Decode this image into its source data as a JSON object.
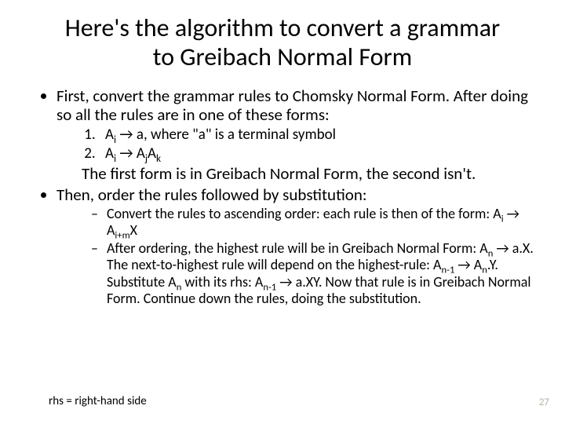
{
  "title": "Here's the algorithm to convert a grammar to Greibach Normal Form",
  "bullet1": "First, convert the grammar rules to Chomsky Normal Form. After doing so all the rules are in one of these forms:",
  "form1_pre": "A",
  "form1_sub": "i",
  "form1_post": " → a,   where \"a\" is a terminal symbol",
  "form2_lhs_pre": "A",
  "form2_lhs_sub": "i",
  "form2_arrow": " → ",
  "form2_r1_pre": "A",
  "form2_r1_sub": "j",
  "form2_r2_pre": "A",
  "form2_r2_sub": "k",
  "midnote": "The first form is in Greibach Normal Form, the second isn't.",
  "bullet2": "Then, order the rules followed by substitution:",
  "dash1_a": "Convert the rules to ascending order: each rule is then of the form: A",
  "dash1_s1": "i",
  "dash1_b": " → A",
  "dash1_s2": "i+m",
  "dash1_c": "X",
  "dash2_a": "After ordering, the highest rule will be in Greibach Normal Form: A",
  "dash2_s1": "n",
  "dash2_b": " → a.X. The next-to-highest rule will depend on the highest-rule: A",
  "dash2_s2": "n-1",
  "dash2_c": " → A",
  "dash2_s3": "n",
  "dash2_d": ".Y. Substitute A",
  "dash2_s4": "n",
  "dash2_e": " with its rhs: A",
  "dash2_s5": "n-1",
  "dash2_f": " → a.XY. Now that rule is in Greibach Normal Form. Continue down the rules, doing the substitution.",
  "footnote": "rhs = right-hand side",
  "pagenum": "27"
}
